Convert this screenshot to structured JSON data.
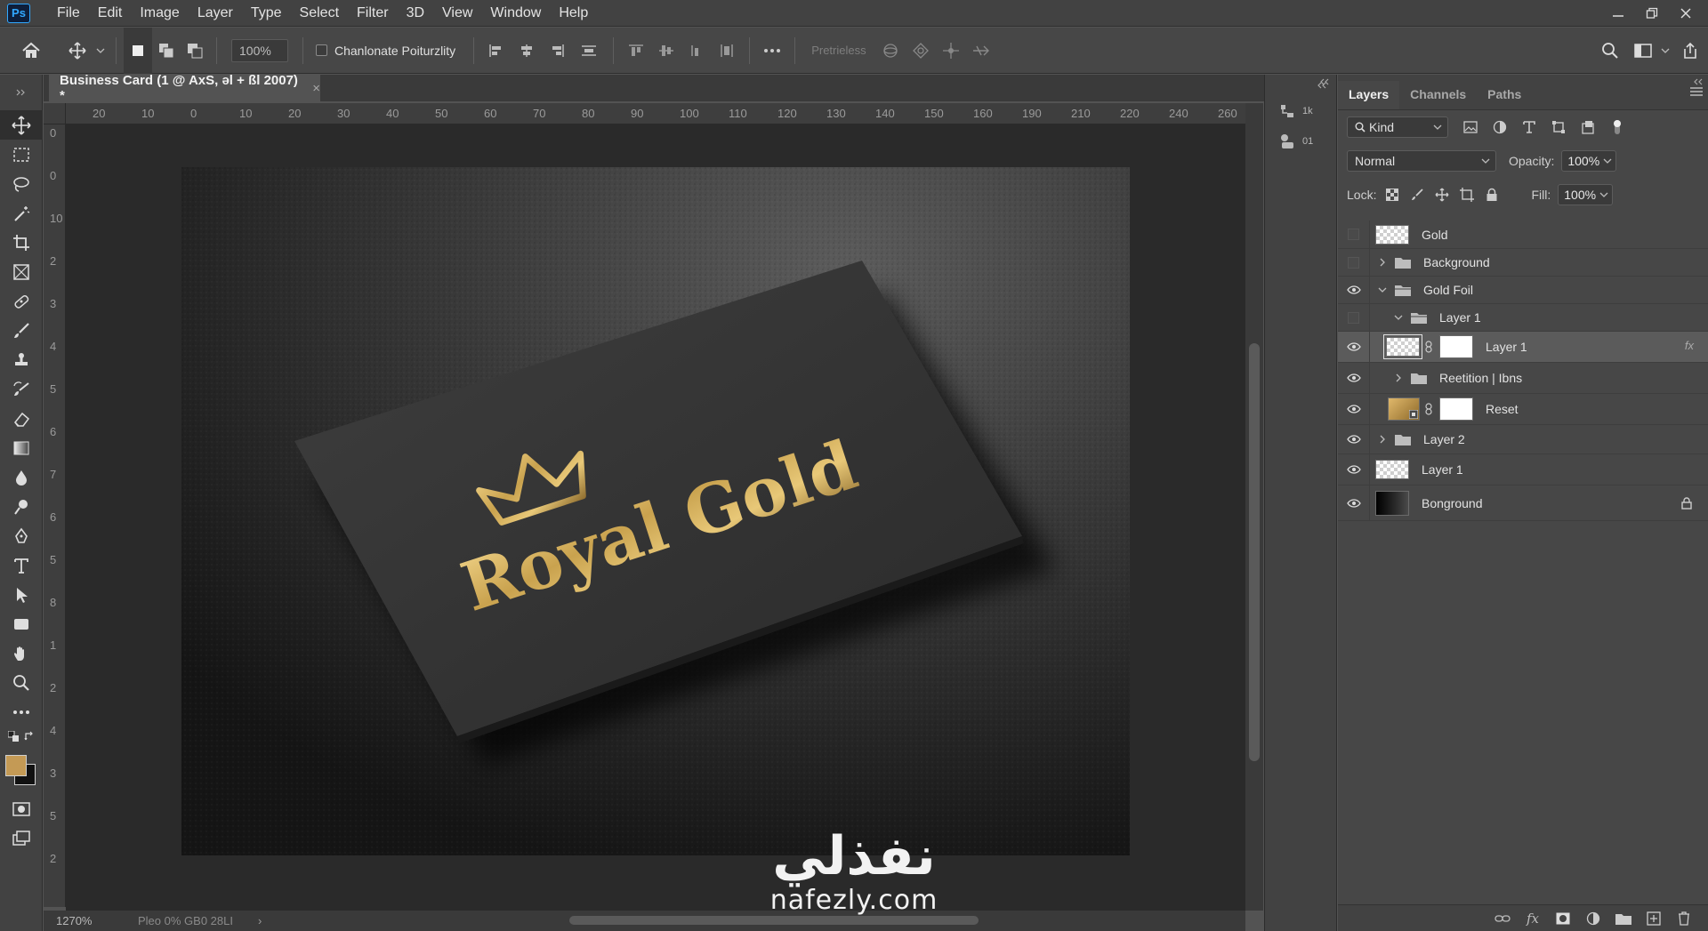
{
  "app": {
    "logo": "Ps"
  },
  "menu": [
    "File",
    "Edit",
    "Image",
    "Layer",
    "Type",
    "Select",
    "Filter",
    "3D",
    "View",
    "Window",
    "Help"
  ],
  "options_bar": {
    "zoom": "100%",
    "checkbox_label": "Chanlonate Poiturzlity",
    "disabled_label": "Pretrieless"
  },
  "document": {
    "tab_title": "Business Card (1 @ AxS, əl + ßl 2007) *",
    "tab_close": "×",
    "ruler_h": [
      "20",
      "10",
      "0",
      "10",
      "20",
      "30",
      "40",
      "50",
      "60",
      "70",
      "80",
      "90",
      "100",
      "110",
      "120",
      "130",
      "140",
      "150",
      "160",
      "190",
      "210",
      "220",
      "240",
      "260"
    ],
    "ruler_v": [
      "0",
      "0",
      "10",
      "2",
      "3",
      "4",
      "5",
      "6",
      "7",
      "6",
      "5",
      "8",
      "1",
      "2",
      "4",
      "3",
      "5",
      "2"
    ],
    "artwork": {
      "brand_text": "Royal Gold",
      "gold": "#c9a24e",
      "card": "#333333"
    }
  },
  "status": {
    "zoom": "1270%",
    "info": "Pleo 0% GB0 28LI",
    "arrow": "›"
  },
  "watermark": {
    "arabic": "نفذلي",
    "latin": "nafezly.com"
  },
  "mid_panel": [
    {
      "icon": "history-icon",
      "label": "1k"
    },
    {
      "icon": "shapes-icon",
      "label": "01"
    }
  ],
  "layers_panel": {
    "tabs": [
      "Layers",
      "Channels",
      "Paths"
    ],
    "filter": "Kind",
    "blend_mode": "Normal",
    "opacity_label": "Opacity:",
    "opacity": "100%",
    "lock_label": "Lock:",
    "fill_label": "Fill:",
    "fill": "100%",
    "layers": [
      {
        "name": "Gold",
        "visible": false,
        "type": "pixel"
      },
      {
        "name": "Background",
        "visible": false,
        "type": "group",
        "expanded": false
      },
      {
        "name": "Gold Foil",
        "visible": true,
        "type": "group",
        "expanded": true
      },
      {
        "name": "Layer 1",
        "visible": false,
        "type": "group",
        "expanded": true
      },
      {
        "name": "Layer 1",
        "visible": true,
        "type": "masked",
        "selected": true
      },
      {
        "name": "Reetition | Ibns",
        "visible": true,
        "type": "group",
        "expanded": false
      },
      {
        "name": "Reset",
        "visible": true,
        "type": "smart-masked"
      },
      {
        "name": "Layer 2",
        "visible": true,
        "type": "group",
        "expanded": false
      },
      {
        "name": "Layer 1",
        "visible": true,
        "type": "pixel"
      },
      {
        "name": "Bonground",
        "visible": true,
        "type": "background",
        "locked": true
      }
    ]
  }
}
